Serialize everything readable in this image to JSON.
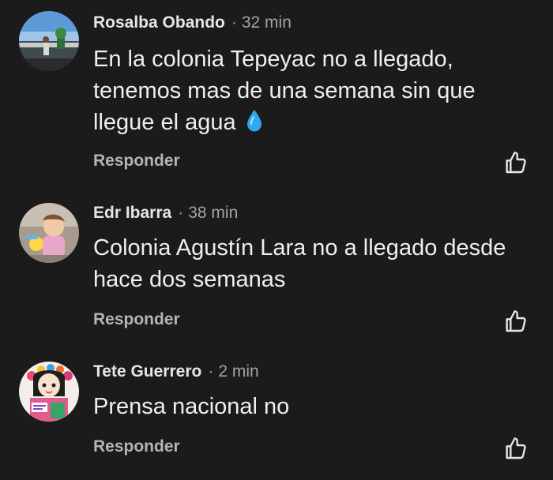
{
  "comments": [
    {
      "author": "Rosalba Obando",
      "separator": "·",
      "time": "32 min",
      "text": "En la colonia Tepeyac no a llegado, tenemos mas de una semana sin que llegue el agua",
      "emoji": "droplet-emoji",
      "reply_label": "Responder",
      "avatar": "photo-person-balcony-sea"
    },
    {
      "author": "Edr Ibarra",
      "separator": "·",
      "time": "38 min",
      "text": "Colonia Agustín Lara no a llegado desde hace dos semanas",
      "reply_label": "Responder",
      "avatar": "photo-child-with-toy"
    },
    {
      "author": "Tete Guerrero",
      "separator": "·",
      "time": "2 min",
      "text": "Prensa nacional no",
      "reply_label": "Responder",
      "avatar": "photo-doll-flower-crown"
    }
  ],
  "icons": {
    "like": "thumbs-up-outline-icon"
  },
  "colors": {
    "background": "#1b1b1b",
    "text": "#efefef",
    "secondary": "#a3a3a3"
  }
}
